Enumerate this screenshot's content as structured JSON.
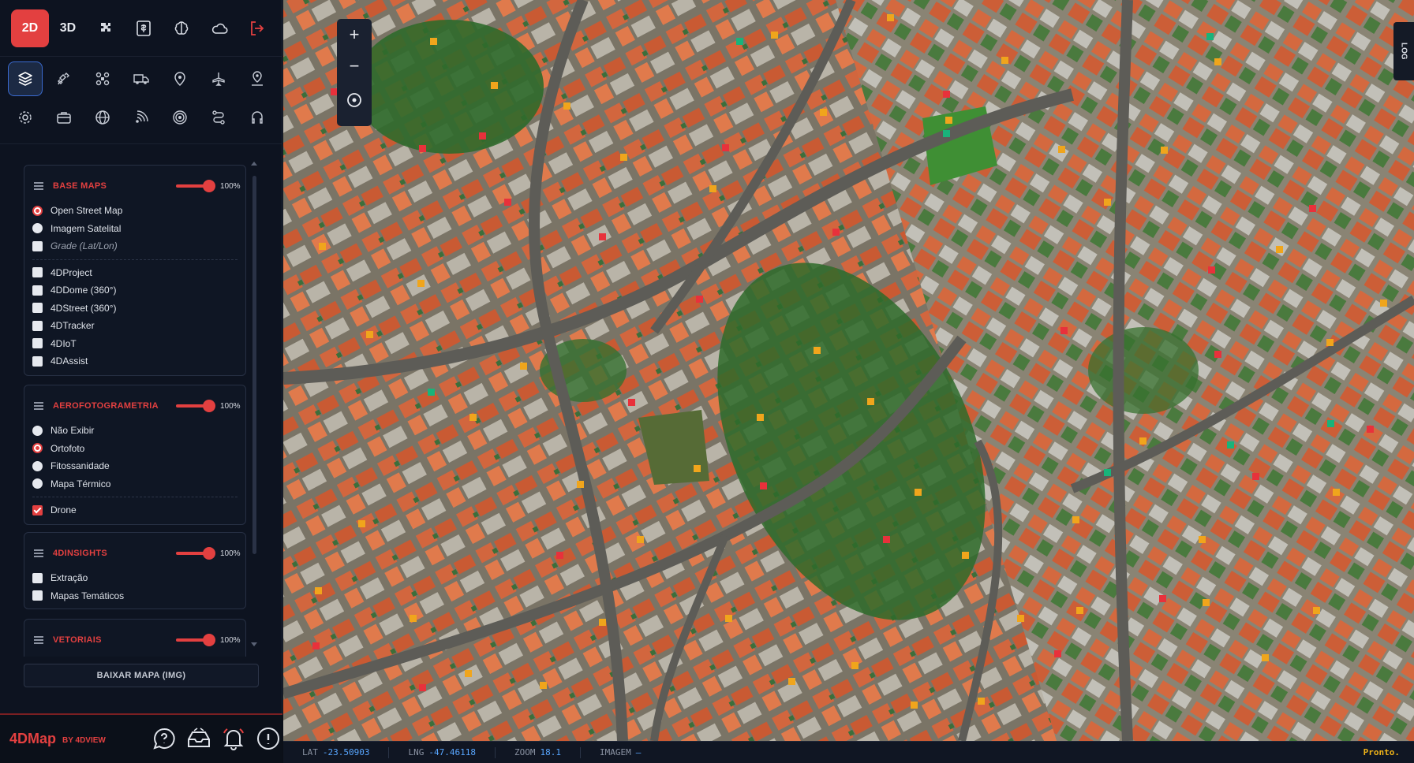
{
  "header": {
    "mode_2d": "2D",
    "mode_3d": "3D",
    "icons": [
      "puzzle-icon",
      "report-icon",
      "brain-icon",
      "cloud-icon",
      "logout-icon"
    ]
  },
  "toolbar": {
    "row1": [
      "layers-icon",
      "satellite-icon",
      "drone-icon",
      "truck-icon",
      "map-pin-icon",
      "plane-icon",
      "user-pin-icon"
    ],
    "row2": [
      "settings-icon",
      "briefcase-icon",
      "globe-icon",
      "signal-icon",
      "target-icon",
      "route-icon",
      "headset-icon"
    ]
  },
  "panels": {
    "base_maps": {
      "title": "BASE MAPS",
      "opacity": "100%",
      "options": [
        "Open Street Map",
        "Imagem Satelital"
      ],
      "selected": "Open Street Map",
      "grid_label": "Grade (Lat/Lon)",
      "layers": [
        "4DProject",
        "4DDome (360°)",
        "4DStreet (360°)",
        "4DTracker",
        "4DIoT",
        "4DAssist"
      ]
    },
    "aerofotogrametria": {
      "title": "AEROFOTOGRAMETRIA",
      "opacity": "100%",
      "options": [
        "Não Exibir",
        "Ortofoto",
        "Fitossanidade",
        "Mapa Térmico"
      ],
      "selected": "Ortofoto",
      "drone_label": "Drone",
      "drone_checked": true
    },
    "insights": {
      "title": "4DINSIGHTS",
      "opacity": "100%",
      "layers": [
        "Extração",
        "Mapas Temáticos"
      ]
    },
    "vetoriais": {
      "title": "VETORIAIS",
      "opacity": "100%"
    }
  },
  "download_button": "BAIXAR MAPA (IMG)",
  "footer": {
    "brand": "4DMap",
    "brand_sub": "BY 4DVIEW",
    "icons": [
      "chat-icon",
      "inbox-icon",
      "bell-icon",
      "info-icon"
    ]
  },
  "map": {
    "zoom_in": "+",
    "zoom_out": "−",
    "log_tab": "LOG"
  },
  "status": {
    "lat_label": "LAT",
    "lat_value": "-23.50903",
    "lng_label": "LNG",
    "lng_value": "-47.46118",
    "zoom_label": "ZOOM",
    "zoom_value": "18.1",
    "image_label": "IMAGEM",
    "image_value": "—",
    "ready": "Pronto."
  },
  "colors": {
    "accent": "#e34040",
    "marker_orange": "#f0a51c",
    "marker_red": "#e8313b",
    "marker_green": "#19b37a",
    "coord_blue": "#58a6ff"
  }
}
